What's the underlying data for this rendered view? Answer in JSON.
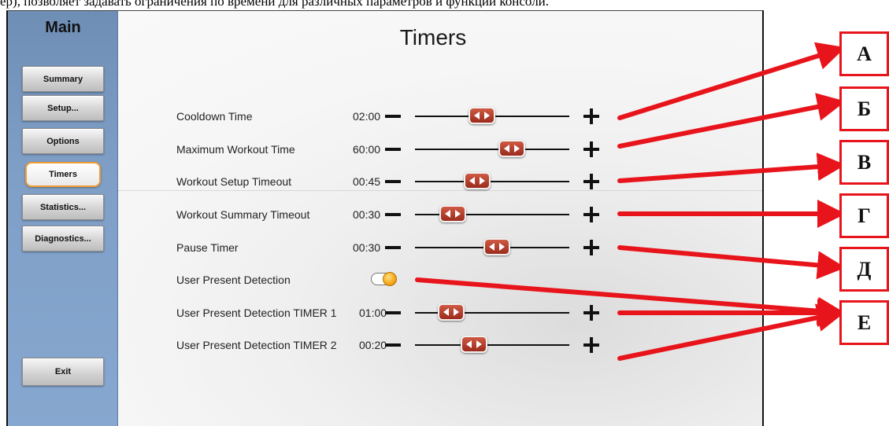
{
  "caption": "ер), позволяет задавать ограничения по времени для различных параметров и функций консоли.",
  "sidebar": {
    "title": "Main",
    "items": [
      {
        "label": "Summary"
      },
      {
        "label": "Setup..."
      },
      {
        "label": "Options"
      },
      {
        "label": "Timers",
        "active": true
      },
      {
        "label": "Statistics..."
      },
      {
        "label": "Diagnostics..."
      }
    ],
    "exit_label": "Exit"
  },
  "page_title": "Timers",
  "timers": [
    {
      "label": "Cooldown Time",
      "value": "02:00"
    },
    {
      "label": "Maximum Workout Time",
      "value": "60:00"
    },
    {
      "label": "Workout Setup Timeout",
      "value": "00:45"
    },
    {
      "label": "Workout Summary Timeout",
      "value": "00:30"
    },
    {
      "label": "Pause Timer",
      "value": "00:30"
    },
    {
      "label": "User Present Detection",
      "toggle": "on"
    },
    {
      "label": "User Present Detection TIMER 1",
      "value": "01:00"
    },
    {
      "label": "User Present Detection TIMER 2",
      "value": "00:20"
    }
  ],
  "callouts": [
    "А",
    "Б",
    "В",
    "Г",
    "Д",
    "Е"
  ],
  "colors": {
    "sidebar": "#7f9fc7",
    "active_outline": "#f09c34",
    "slider_thumb": "#b3402c",
    "toggle_knob": "#f3a51a",
    "annotation": "#e8141b"
  }
}
